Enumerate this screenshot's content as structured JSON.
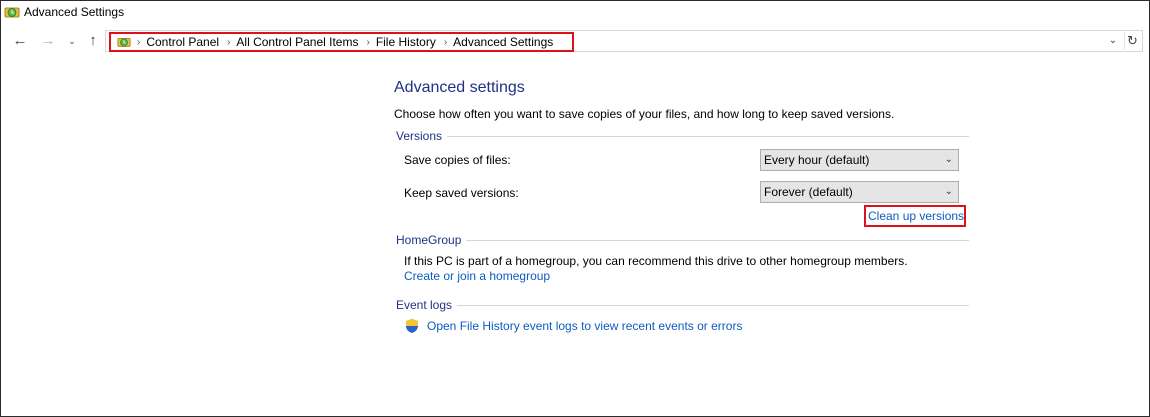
{
  "window": {
    "title": "Advanced Settings"
  },
  "nav": {
    "back_icon": "back-arrow-icon",
    "forward_icon": "forward-arrow-icon",
    "recent_icon": "chevron-down-icon",
    "up_icon": "up-arrow-icon"
  },
  "breadcrumb": {
    "items": [
      "Control Panel",
      "All Control Panel Items",
      "File History",
      "Advanced Settings"
    ]
  },
  "content": {
    "title": "Advanced settings",
    "description": "Choose how often you want to save copies of your files, and how long to keep saved versions.",
    "versions": {
      "heading": "Versions",
      "save_copies_label": "Save copies of files:",
      "save_copies_value": "Every hour (default)",
      "keep_versions_label": "Keep saved versions:",
      "keep_versions_value": "Forever (default)",
      "cleanup_link": "Clean up versions"
    },
    "homegroup": {
      "heading": "HomeGroup",
      "text": "If this PC is part of a homegroup, you can recommend this drive to other homegroup members.",
      "link": "Create or join a homegroup"
    },
    "event_logs": {
      "heading": "Event logs",
      "link": "Open File History event logs to view recent events or errors"
    }
  },
  "colors": {
    "accent_title": "#1e3287",
    "link": "#0f5bc0",
    "highlight_box": "#e0101a"
  }
}
